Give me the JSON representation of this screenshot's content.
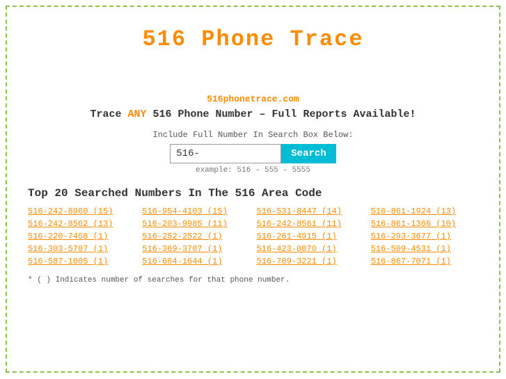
{
  "page": {
    "title": "516 Phone Trace",
    "site_url": "516phonetrace.com",
    "tagline_start": "Trace ",
    "tagline_any": "ANY",
    "tagline_end": " 516 Phone Number – Full Reports Available!",
    "search_label": "Include Full Number In Search Box Below:",
    "search_input_value": "516-",
    "search_button_label": "Search",
    "search_example": "example: 516 – 555 – 5555",
    "section_title": "Top 20 Searched Numbers In The 516 Area Code",
    "footnote": "* ( ) Indicates number of searches for that phone number.",
    "numbers": [
      "516-242-8960 (15)",
      "516-954-4103 (15)",
      "516-531-8447 (14)",
      "516-861-1924 (13)",
      "516-242-8562 (13)",
      "516-203-9985 (11)",
      "516-242-8561 (11)",
      "516-861-1366 (10)",
      "516-220-7458 (1)",
      "516-252-2522 (1)",
      "516-261-4915 (1)",
      "516-293-3677 (1)",
      "516-303-5707 (1)",
      "516-369-3707 (1)",
      "516-423-0870 (1)",
      "516-509-4531 (1)",
      "516-587-1005 (1)",
      "516-664-1644 (1)",
      "516-789-3221 (1)",
      "516-867-7071 (1)"
    ]
  }
}
